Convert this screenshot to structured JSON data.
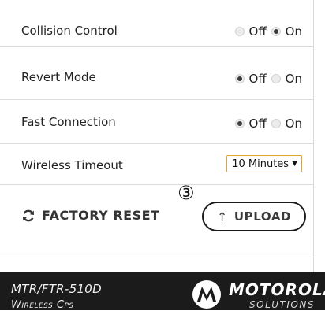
{
  "settings": [
    {
      "label": "Collision Control",
      "options": [
        "Off",
        "On"
      ],
      "selected": "On"
    },
    {
      "label": "Revert Mode",
      "options": [
        "Off",
        "On"
      ],
      "selected": "Off"
    },
    {
      "label": "Fast Connection",
      "options": [
        "Off",
        "On"
      ],
      "selected": "Off"
    }
  ],
  "wireless_timeout": {
    "label": "Wireless Timeout",
    "value": "10 Minutes"
  },
  "actions": {
    "factory_reset_label": "FACTORY RESET",
    "upload_label": "UPLOAD",
    "step_marker": "③"
  },
  "footer": {
    "model": "MTR/FTR-510D",
    "subtitle": "Wireless Cps",
    "brand": "MOTOROLA",
    "brand_sub": "SOLUTIONS"
  },
  "colors": {
    "select_border": "#e3a42c",
    "footer_bg": "#1b1b1b"
  },
  "icons": {
    "factory_reset": "refresh-icon",
    "upload": "arrow-up-icon",
    "logo": "motorola-batwing-logo"
  }
}
